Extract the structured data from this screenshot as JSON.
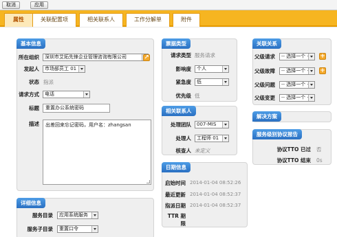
{
  "toolbar": {
    "cancel": "取消",
    "apply": "应用"
  },
  "tabs": [
    "属性",
    "关联配置项",
    "相关联系人",
    "工作分解单",
    "附件"
  ],
  "basic": {
    "title": "基本信息",
    "org_label": "所在组织",
    "org_value": "深圳市艾拓先锋企业管理咨询有限公司",
    "initiator_label": "发起人",
    "initiator_value": "市场部员工 01",
    "status_label": "状态",
    "status_value": "指派",
    "method_label": "请求方式",
    "method_value": "电话",
    "subject_label": "标题",
    "subject_value": "重置办公系统密码",
    "desc_label": "描述",
    "desc_value": "出差回来忘记密码，用户名：zhangsan"
  },
  "ticket": {
    "title": "票据类型",
    "type_label": "请求类型",
    "type_value": "服务请求",
    "impact_label": "影响度",
    "impact_value": "个人",
    "urgency_label": "紧急度",
    "urgency_value": "低",
    "priority_label": "优先级",
    "priority_value": "低"
  },
  "contacts": {
    "title": "相关联系人",
    "team_label": "处理团队",
    "team_value": "007-MIS",
    "handler_label": "处理人",
    "handler_value": "工程师 01",
    "checker_label": "核查人",
    "checker_value": "未定义"
  },
  "dates": {
    "title": "日期信息",
    "start_label": "启始时间",
    "start_value": "2014-01-04 08:52:26",
    "update_label": "最近更新",
    "update_value": "2014-01-04 08:52:37",
    "assign_label": "指派日期",
    "assign_value": "2014-01-04 08:52:37",
    "ttr_label": "TTR 期限"
  },
  "relations": {
    "title": "关联关系",
    "items": [
      {
        "label": "父级请求",
        "value": "-- 选择一个 --"
      },
      {
        "label": "父级故障",
        "value": "-- 选择一个 --"
      },
      {
        "label": "父级问题",
        "value": "-- 选择一个 --"
      },
      {
        "label": "父级变更",
        "value": "-- 选择一个 --"
      }
    ]
  },
  "solution": {
    "title": "解决方案"
  },
  "sla": {
    "title": "服务级别协议报告",
    "tto_label": "协议TTO 已过",
    "tto_value": "否",
    "ttr_label": "协议TTO 结束",
    "ttr_value": "0s"
  },
  "detail": {
    "title": "详细信息",
    "catalog_label": "服务目录",
    "catalog_value": "应用系统服务",
    "subcatalog_label": "服务子目录",
    "subcatalog_value": "重置口令"
  },
  "colors": {
    "tab_strip": "#f6b521",
    "panel_title": "#2a70c2",
    "add_button": "#f4a92b"
  }
}
